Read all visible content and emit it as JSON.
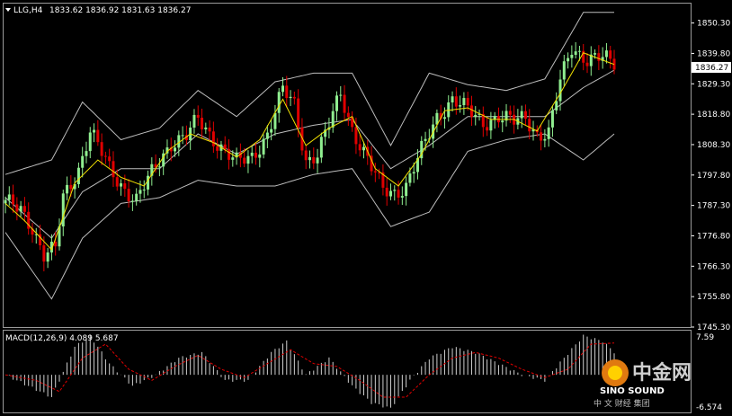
{
  "header": {
    "symbol_label": "LLG,H4",
    "ohlc": "1833.62 1836.92 1831.63 1836.27"
  },
  "price_axis": {
    "labels": [
      "1850.30",
      "1839.80",
      "1829.30",
      "1818.80",
      "1808.30",
      "1797.80",
      "1787.30",
      "1776.80",
      "1766.30",
      "1755.80",
      "1745.30"
    ],
    "current_price": "1836.27"
  },
  "macd": {
    "title": "MACD(12,26,9) 4.089 5.687",
    "axis_top": "7.59",
    "axis_bottom": "-6.574"
  },
  "watermark": {
    "cn": "中金网",
    "en": "SINO SOUND",
    "sub": "中 文   财经   集团"
  },
  "colors": {
    "background": "#000000",
    "bull": "#90ee90",
    "bear": "#e00000",
    "bands": "#bdbdbd",
    "ma": "#f0e000",
    "macd_hist": "#d0d0d0",
    "macd_signal": "#e00000",
    "text": "#ffffff"
  },
  "chart_data": {
    "type": "candlestick",
    "symbol": "LLG",
    "timeframe": "H4",
    "ylim": [
      1745.3,
      1857.0
    ],
    "close_keyframes": [
      [
        0,
        1788
      ],
      [
        4,
        1786
      ],
      [
        7,
        1780
      ],
      [
        10,
        1770
      ],
      [
        13,
        1772
      ],
      [
        15,
        1790
      ],
      [
        19,
        1800
      ],
      [
        22,
        1813
      ],
      [
        27,
        1800
      ],
      [
        31,
        1793
      ],
      [
        34,
        1789
      ],
      [
        37,
        1796
      ],
      [
        40,
        1803
      ],
      [
        43,
        1809
      ],
      [
        47,
        1811
      ],
      [
        50,
        1817
      ],
      [
        53,
        1812
      ],
      [
        57,
        1806
      ],
      [
        60,
        1802
      ],
      [
        64,
        1804
      ],
      [
        68,
        1812
      ],
      [
        72,
        1827
      ],
      [
        75,
        1822
      ],
      [
        78,
        1803
      ],
      [
        81,
        1805
      ],
      [
        84,
        1815
      ],
      [
        87,
        1826
      ],
      [
        90,
        1814
      ],
      [
        95,
        1800
      ],
      [
        98,
        1793
      ],
      [
        101,
        1792
      ],
      [
        104,
        1794
      ],
      [
        108,
        1806
      ],
      [
        112,
        1818
      ],
      [
        116,
        1824
      ],
      [
        120,
        1820
      ],
      [
        124,
        1816
      ],
      [
        128,
        1818
      ],
      [
        132,
        1816
      ],
      [
        135,
        1818
      ],
      [
        138,
        1812
      ],
      [
        141,
        1812
      ],
      [
        144,
        1830
      ],
      [
        147,
        1842
      ],
      [
        151,
        1838
      ],
      [
        155,
        1838
      ],
      [
        158,
        1836.27
      ]
    ],
    "bands": {
      "upper": [
        [
          0,
          1798
        ],
        [
          12,
          1803
        ],
        [
          20,
          1823
        ],
        [
          30,
          1810
        ],
        [
          40,
          1814
        ],
        [
          50,
          1827
        ],
        [
          60,
          1818
        ],
        [
          70,
          1830
        ],
        [
          80,
          1833
        ],
        [
          90,
          1833
        ],
        [
          100,
          1808
        ],
        [
          110,
          1833
        ],
        [
          120,
          1829
        ],
        [
          130,
          1827
        ],
        [
          140,
          1831
        ],
        [
          150,
          1854
        ],
        [
          158,
          1854
        ]
      ],
      "lower": [
        [
          0,
          1778
        ],
        [
          12,
          1755
        ],
        [
          20,
          1776
        ],
        [
          30,
          1788
        ],
        [
          40,
          1790
        ],
        [
          50,
          1796
        ],
        [
          60,
          1794
        ],
        [
          70,
          1794
        ],
        [
          80,
          1798
        ],
        [
          90,
          1800
        ],
        [
          100,
          1780
        ],
        [
          110,
          1785
        ],
        [
          120,
          1806
        ],
        [
          130,
          1810
        ],
        [
          140,
          1812
        ],
        [
          150,
          1803
        ],
        [
          158,
          1812
        ]
      ],
      "middle": [
        [
          0,
          1790
        ],
        [
          12,
          1776
        ],
        [
          20,
          1792
        ],
        [
          30,
          1800
        ],
        [
          40,
          1800
        ],
        [
          50,
          1812
        ],
        [
          60,
          1805
        ],
        [
          70,
          1812
        ],
        [
          80,
          1815
        ],
        [
          90,
          1817
        ],
        [
          100,
          1800
        ],
        [
          110,
          1808
        ],
        [
          120,
          1818
        ],
        [
          130,
          1818
        ],
        [
          140,
          1818
        ],
        [
          150,
          1828
        ],
        [
          158,
          1834
        ]
      ]
    },
    "ma": [
      [
        0,
        1788
      ],
      [
        5,
        1782
      ],
      [
        12,
        1772
      ],
      [
        18,
        1795
      ],
      [
        24,
        1803
      ],
      [
        30,
        1797
      ],
      [
        36,
        1794
      ],
      [
        42,
        1806
      ],
      [
        48,
        1812
      ],
      [
        54,
        1809
      ],
      [
        60,
        1804
      ],
      [
        66,
        1810
      ],
      [
        72,
        1824
      ],
      [
        78,
        1808
      ],
      [
        84,
        1814
      ],
      [
        90,
        1818
      ],
      [
        96,
        1800
      ],
      [
        102,
        1794
      ],
      [
        108,
        1805
      ],
      [
        114,
        1820
      ],
      [
        120,
        1821
      ],
      [
        126,
        1817
      ],
      [
        132,
        1817
      ],
      [
        138,
        1813
      ],
      [
        144,
        1826
      ],
      [
        150,
        1840
      ],
      [
        158,
        1836
      ]
    ],
    "macd": {
      "ylim": [
        -6.574,
        7.59
      ],
      "hist_keyframes": [
        [
          0,
          0
        ],
        [
          6,
          -2
        ],
        [
          12,
          -4
        ],
        [
          18,
          5
        ],
        [
          22,
          7
        ],
        [
          27,
          2
        ],
        [
          33,
          -2
        ],
        [
          39,
          0
        ],
        [
          45,
          3
        ],
        [
          51,
          4
        ],
        [
          57,
          -1
        ],
        [
          63,
          -1
        ],
        [
          69,
          4
        ],
        [
          73,
          6
        ],
        [
          78,
          0
        ],
        [
          84,
          3
        ],
        [
          90,
          -2
        ],
        [
          95,
          -5
        ],
        [
          100,
          -6
        ],
        [
          105,
          -1
        ],
        [
          110,
          3
        ],
        [
          116,
          5
        ],
        [
          122,
          4
        ],
        [
          128,
          2
        ],
        [
          134,
          0
        ],
        [
          140,
          -1
        ],
        [
          145,
          3
        ],
        [
          150,
          7
        ],
        [
          155,
          6
        ],
        [
          158,
          4.089
        ]
      ],
      "signal_keyframes": [
        [
          0,
          0
        ],
        [
          8,
          -1
        ],
        [
          14,
          -3
        ],
        [
          20,
          3
        ],
        [
          26,
          5.5
        ],
        [
          32,
          1
        ],
        [
          38,
          -1
        ],
        [
          44,
          1.5
        ],
        [
          50,
          3.5
        ],
        [
          56,
          1
        ],
        [
          62,
          -0.5
        ],
        [
          68,
          2
        ],
        [
          74,
          4.5
        ],
        [
          80,
          2
        ],
        [
          86,
          1.5
        ],
        [
          92,
          -1
        ],
        [
          98,
          -4
        ],
        [
          104,
          -4
        ],
        [
          110,
          0
        ],
        [
          116,
          3
        ],
        [
          122,
          4
        ],
        [
          128,
          3
        ],
        [
          134,
          1
        ],
        [
          140,
          -0.5
        ],
        [
          146,
          1
        ],
        [
          152,
          5.5
        ],
        [
          158,
          5.687
        ]
      ]
    }
  }
}
